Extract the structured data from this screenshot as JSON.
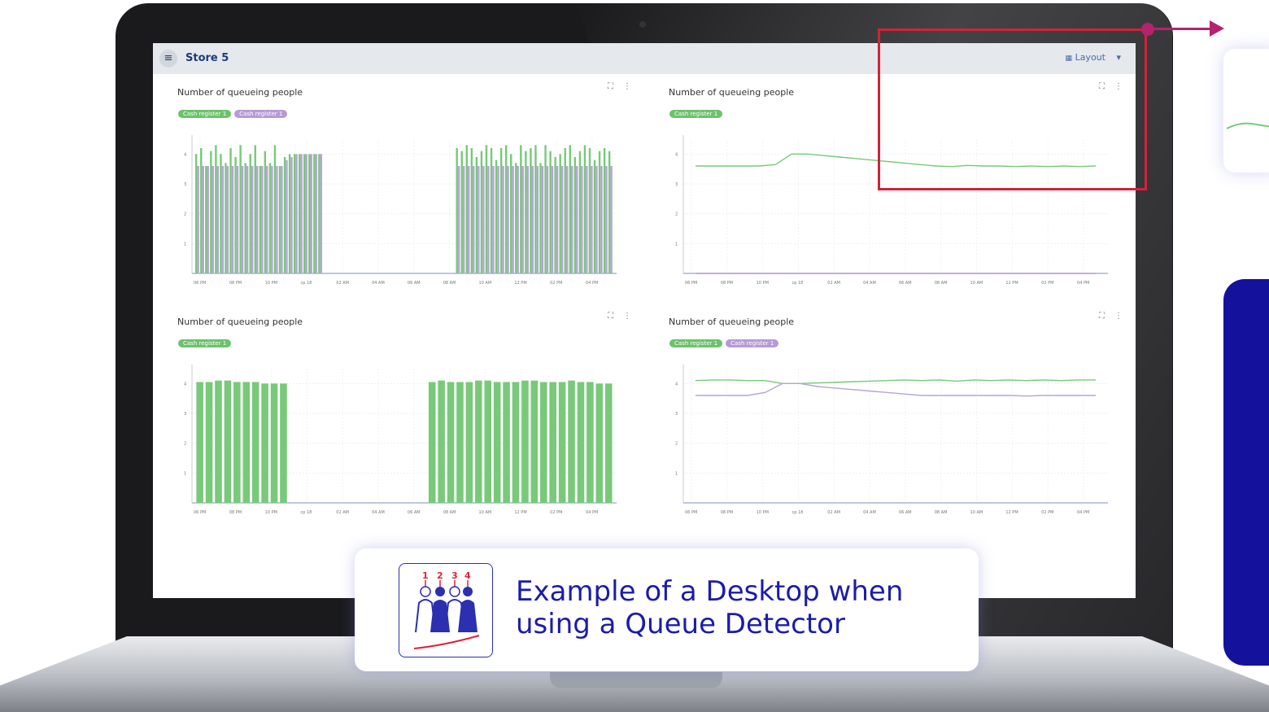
{
  "app": {
    "menu_icon": "hamburger-icon",
    "store_title": "Store 5",
    "layout_label": "Layout",
    "layout_icon": "grid-icon",
    "layout_dropdown_icon": "caret-down-icon"
  },
  "panels": [
    {
      "title": "Number of queueing people",
      "tags": [
        "Cash register 1",
        "Cash register 1"
      ],
      "tag_colors": [
        "#6cc26c",
        "#b69ad6"
      ]
    },
    {
      "title": "Number of queueing people",
      "tags": [
        "Cash register 1"
      ],
      "tag_colors": [
        "#6cc26c"
      ]
    },
    {
      "title": "Number of queueing people",
      "tags": [
        "Cash register 1"
      ],
      "tag_colors": [
        "#6cc26c"
      ]
    },
    {
      "title": "Number of queueing people",
      "tags": [
        "Cash register 1",
        "Cash register 1"
      ],
      "tag_colors": [
        "#6cc26c",
        "#b69ad6"
      ]
    }
  ],
  "panel_tools": {
    "expand": "⛶",
    "more": "⋮"
  },
  "colors": {
    "green": "#79c97a",
    "purple": "#b8a3d8",
    "brand_blue": "#1c1ca8",
    "annotation_red": "#d6203a",
    "arrow_magenta": "#b4236e"
  },
  "chart_data": [
    {
      "type": "bar",
      "title": "Number of queueing people",
      "x_ticks": [
        "06 PM",
        "08 PM",
        "10 PM",
        "ср 18",
        "02 AM",
        "04 AM",
        "06 AM",
        "08 AM",
        "10 AM",
        "12 PM",
        "02 PM",
        "04 PM"
      ],
      "ylim": [
        0,
        4.5
      ],
      "y_ticks": [
        1,
        2,
        3,
        4
      ],
      "series": [
        {
          "name": "Cash register 1",
          "values": [
            4.0,
            4.2,
            3.6,
            4.1,
            4.3,
            4.0,
            3.7,
            4.2,
            3.9,
            4.3,
            3.7,
            4.0,
            4.3,
            3.6,
            4.1,
            3.7,
            4.3,
            3.6,
            3.9,
            4.0,
            4.0,
            4.0,
            4.0,
            4.0,
            4.0,
            4.0,
            0,
            0,
            0,
            0,
            0,
            0,
            0,
            0,
            0,
            0,
            0,
            0,
            0,
            0,
            0,
            0,
            0,
            0,
            0,
            0,
            0,
            0,
            0,
            0,
            0,
            0,
            0,
            4.2,
            4.1,
            4.3,
            4.2,
            3.9,
            4.1,
            4.3,
            4.2,
            3.8,
            4.2,
            4.3,
            4.0,
            3.7,
            4.3,
            4.1,
            4.2,
            4.3,
            3.7,
            4.3,
            4.1,
            3.9,
            4.0,
            4.2,
            4.3,
            3.9,
            4.1,
            4.3,
            4.2,
            3.8,
            4.1,
            4.2,
            4.1
          ]
        },
        {
          "name": "Cash register 1",
          "values": [
            3.6,
            3.6,
            3.6,
            3.6,
            3.6,
            3.6,
            3.6,
            3.6,
            3.6,
            3.6,
            3.6,
            3.6,
            3.6,
            3.6,
            3.6,
            3.6,
            3.6,
            3.6,
            3.8,
            3.9,
            4.0,
            4.0,
            4.0,
            4.0,
            4.0,
            4.0,
            0,
            0,
            0,
            0,
            0,
            0,
            0,
            0,
            0,
            0,
            0,
            0,
            0,
            0,
            0,
            0,
            0,
            0,
            0,
            0,
            0,
            0,
            0,
            0,
            0,
            0,
            0,
            3.6,
            3.6,
            3.6,
            3.6,
            3.6,
            3.6,
            3.6,
            3.6,
            3.6,
            3.6,
            3.6,
            3.6,
            3.6,
            3.6,
            3.6,
            3.6,
            3.6,
            3.6,
            3.6,
            3.6,
            3.6,
            3.6,
            3.6,
            3.6,
            3.6,
            3.6,
            3.6,
            3.6,
            3.6,
            3.6,
            3.6,
            3.6
          ]
        }
      ]
    },
    {
      "type": "line",
      "title": "Number of queueing people",
      "x_ticks": [
        "06 PM",
        "08 PM",
        "10 PM",
        "ср 18",
        "02 AM",
        "04 AM",
        "06 AM",
        "08 AM",
        "10 AM",
        "12 PM",
        "02 PM",
        "04 PM"
      ],
      "ylim": [
        0,
        4.5
      ],
      "y_ticks": [
        1,
        2,
        3,
        4
      ],
      "series": [
        {
          "name": "Cash register 1",
          "values": [
            3.6,
            3.6,
            3.6,
            3.6,
            3.6,
            3.65,
            4.0,
            4.0,
            3.95,
            3.9,
            3.85,
            3.8,
            3.75,
            3.7,
            3.65,
            3.6,
            3.58,
            3.62,
            3.6,
            3.6,
            3.58,
            3.6,
            3.58,
            3.6,
            3.58,
            3.6
          ]
        },
        {
          "name": "Cash register 1",
          "values": [
            0,
            0,
            0,
            0,
            0,
            0,
            0,
            0,
            0,
            0,
            0,
            0,
            0,
            0,
            0,
            0,
            0,
            0,
            0,
            0,
            0,
            0,
            0,
            0,
            0,
            0
          ]
        }
      ]
    },
    {
      "type": "bar",
      "title": "Number of queueing people",
      "x_ticks": [
        "06 PM",
        "08 PM",
        "10 PM",
        "ср 18",
        "02 AM",
        "04 AM",
        "06 AM",
        "08 AM",
        "10 AM",
        "12 PM",
        "02 PM",
        "04 PM"
      ],
      "ylim": [
        0,
        4.5
      ],
      "y_ticks": [
        1,
        2,
        3,
        4
      ],
      "series": [
        {
          "name": "Cash register 1",
          "values": [
            4.05,
            4.05,
            4.1,
            4.1,
            4.05,
            4.05,
            4.05,
            4.0,
            4.0,
            4.0,
            0,
            0,
            0,
            0,
            0,
            0,
            0,
            0,
            0,
            0,
            0,
            0,
            0,
            0,
            0,
            4.05,
            4.1,
            4.05,
            4.05,
            4.05,
            4.1,
            4.1,
            4.05,
            4.05,
            4.05,
            4.1,
            4.1,
            4.05,
            4.05,
            4.05,
            4.1,
            4.05,
            4.05,
            4.0,
            4.0
          ]
        }
      ]
    },
    {
      "type": "line",
      "title": "Number of queueing people",
      "x_ticks": [
        "06 PM",
        "08 PM",
        "10 PM",
        "ср 18",
        "02 AM",
        "04 AM",
        "06 AM",
        "08 AM",
        "10 AM",
        "12 PM",
        "02 PM",
        "04 PM"
      ],
      "ylim": [
        0,
        4.5
      ],
      "y_ticks": [
        1,
        2,
        3,
        4
      ],
      "series": [
        {
          "name": "Cash register 1",
          "values": [
            4.1,
            4.12,
            4.12,
            4.1,
            4.1,
            4.0,
            4.0,
            4.02,
            4.04,
            4.06,
            4.08,
            4.1,
            4.12,
            4.1,
            4.12,
            4.08,
            4.12,
            4.1,
            4.12,
            4.1,
            4.12,
            4.1,
            4.12,
            4.12
          ]
        },
        {
          "name": "Cash register 1",
          "values": [
            3.6,
            3.6,
            3.6,
            3.6,
            3.7,
            4.0,
            4.0,
            3.9,
            3.85,
            3.8,
            3.75,
            3.7,
            3.65,
            3.6,
            3.6,
            3.6,
            3.6,
            3.6,
            3.6,
            3.58,
            3.6,
            3.6,
            3.6,
            3.6
          ]
        }
      ]
    }
  ],
  "caption": {
    "icon": "queue-people-icon",
    "icon_numbers": [
      "1",
      "2",
      "3",
      "4"
    ],
    "text": "Example of a Desktop when using a Queue Detector"
  }
}
